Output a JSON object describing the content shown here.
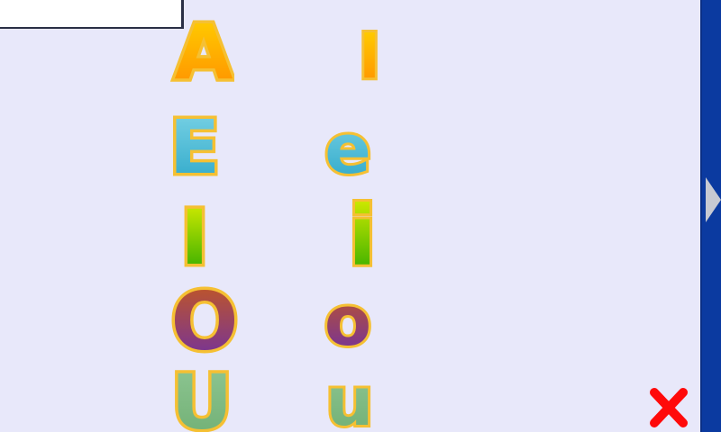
{
  "app": {
    "top_box_text": ""
  },
  "uppercase": [
    "A",
    "E",
    "I",
    "O",
    "U"
  ],
  "lowercase": [
    "l",
    "e",
    "i",
    "o",
    "u"
  ],
  "controls": {
    "next_icon": "triangle-right",
    "close_icon": "x-mark"
  },
  "colors": {
    "background": "#e8e8fa",
    "sidebar": "#0b3aa0",
    "close": "#ff0a0a",
    "outline": "#f5c033",
    "A": [
      "#ffd400",
      "#ff8c00"
    ],
    "E": [
      "#7dd4e6",
      "#2aa6c8"
    ],
    "I": [
      "#e6f200",
      "#22a600"
    ],
    "O": [
      "#c85a1a",
      "#6b2ea8"
    ],
    "U": [
      "#8fc794",
      "#6fae72"
    ]
  }
}
